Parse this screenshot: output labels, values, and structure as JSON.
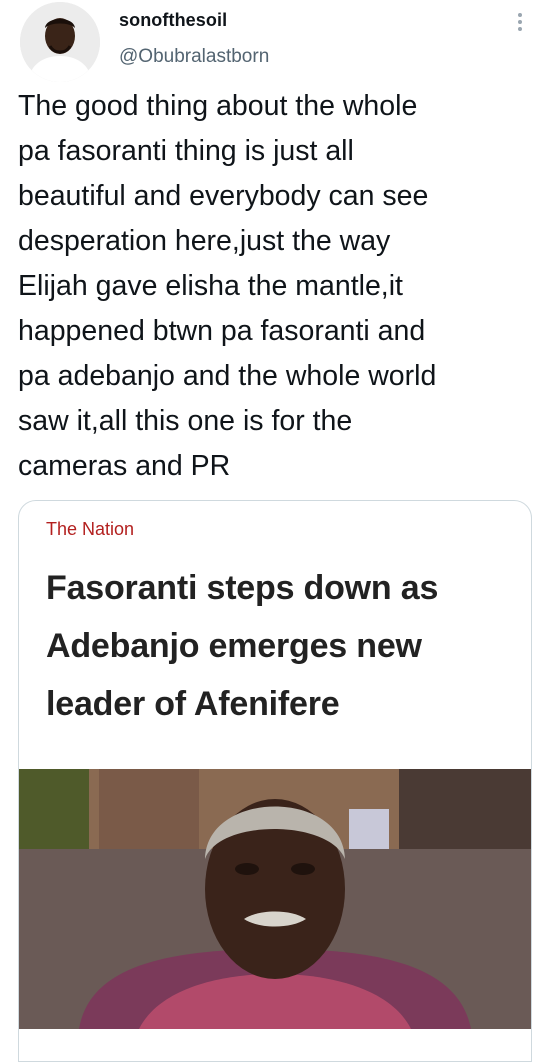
{
  "author": {
    "display_name": "sonofthesoil",
    "handle": "@Obubralastborn",
    "avatar_icon": "avatar-photo",
    "more_icon": "more-vertical-icon"
  },
  "tweet": {
    "text": "The good thing about the whole\npa fasoranti thing is just all\nbeautiful and everybody can see\ndesperation here,just the way\nElijah gave elisha the mantle,it\nhappened btwn pa fasoranti and\npa adebanjo and the whole world\nsaw it,all this one is for the\ncameras and PR"
  },
  "link_card": {
    "source": "The Nation",
    "headline": "Fasoranti steps down as Adebanjo emerges new leader of Afenifere",
    "image_icon": "elderly-man-photo",
    "source_color": "#b3201f"
  }
}
